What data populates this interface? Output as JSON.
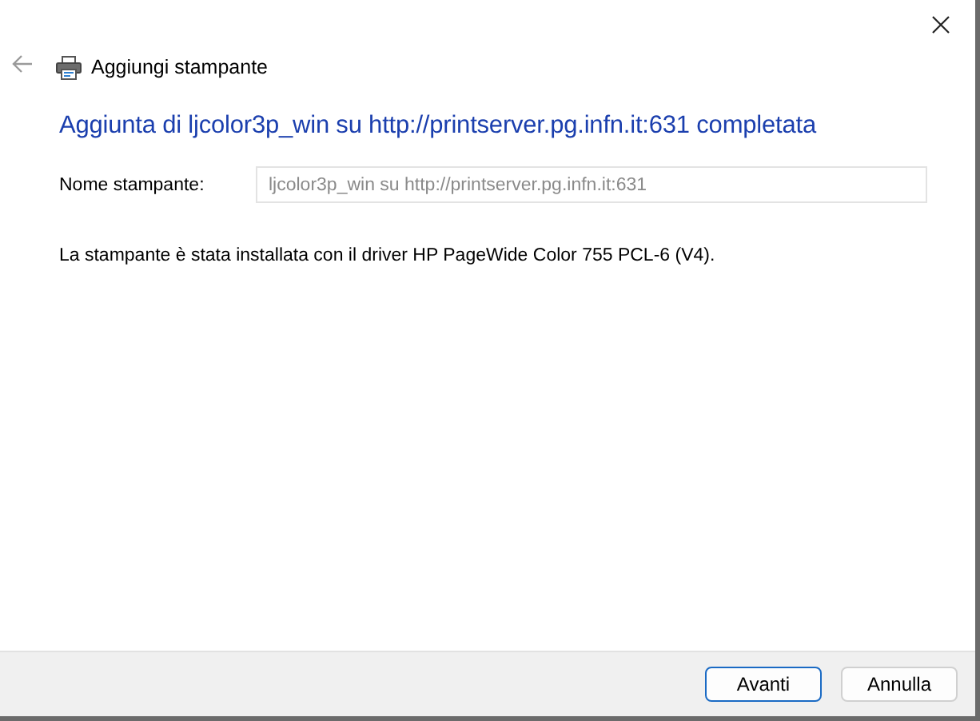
{
  "window": {
    "title": "Aggiungi stampante"
  },
  "heading": "Aggiunta di ljcolor3p_win su http://printserver.pg.infn.it:631 completata",
  "printer_name": {
    "label": "Nome stampante:",
    "value": "ljcolor3p_win su http://printserver.pg.infn.it:631",
    "disabled": true
  },
  "message": "La stampante è stata installata con il driver HP PageWide Color 755 PCL-6 (V4).",
  "buttons": [
    {
      "label": "Avanti",
      "default": true
    },
    {
      "label": "Annulla",
      "default": false
    }
  ]
}
